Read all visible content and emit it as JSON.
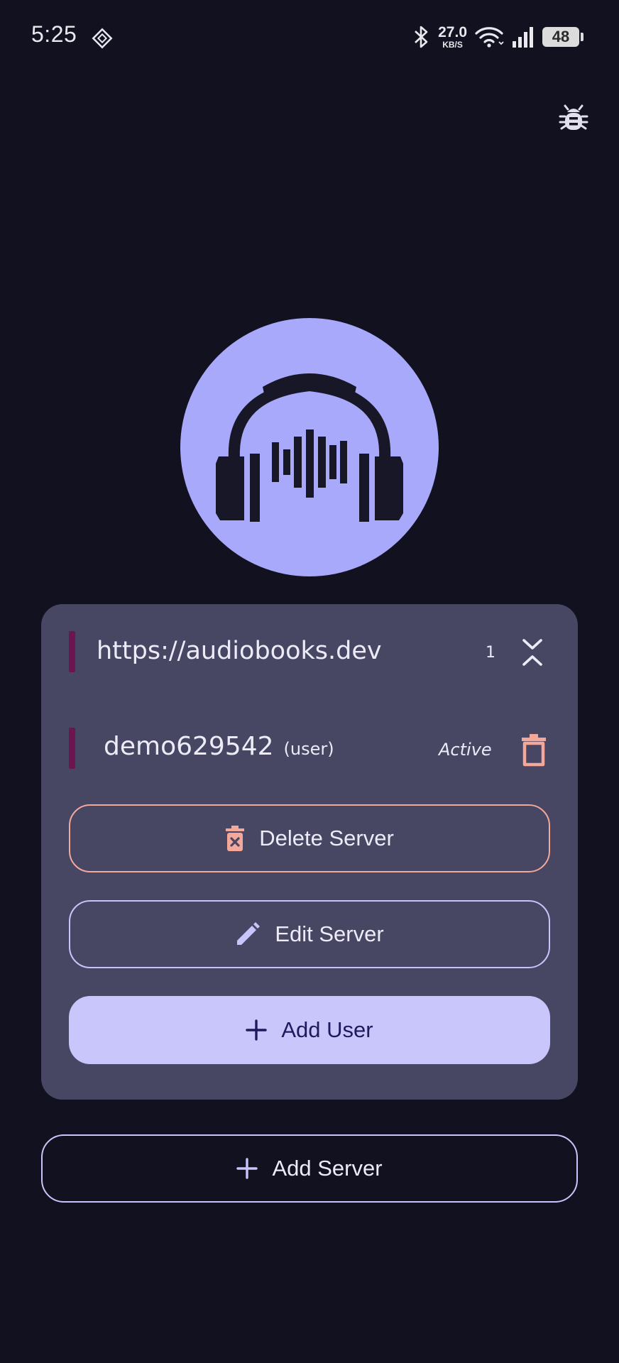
{
  "status_bar": {
    "time": "5:25",
    "net_speed_value": "27.0",
    "net_speed_unit": "KB/S",
    "battery": "48",
    "icons": [
      "notification-diamond-icon",
      "bluetooth-icon",
      "wifi-icon",
      "cellular-signal-icon",
      "battery-icon"
    ]
  },
  "header": {
    "debug_icon": "bug-icon"
  },
  "logo": {
    "icon": "headphones-waveform-icon",
    "background_color": "#a9a9fb"
  },
  "server": {
    "url": "https://audiobooks.dev",
    "user_count": "1",
    "users": [
      {
        "username": "demo629542",
        "role": "(user)",
        "status": "Active"
      }
    ],
    "delete_server_label": "Delete Server",
    "edit_server_label": "Edit Server",
    "add_user_label": "Add User"
  },
  "add_server_label": "Add Server",
  "colors": {
    "background": "#11111f",
    "card": "#474764",
    "accent_bar": "#6c1550",
    "danger": "#f4a89a",
    "primary": "#c8c6fb",
    "primary_text": "#1d1a5e"
  }
}
